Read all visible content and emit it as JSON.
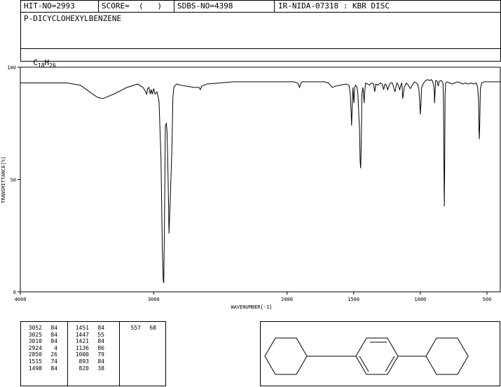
{
  "header": {
    "hit_no": "HIT-NO=2993",
    "score": "SCORE=  (   )",
    "sdbs_no": "SDBS-NO=4398",
    "ir_info": "IR-NIDA-07318 : KBR DISC",
    "compound_name": "P-DICYCLOHEXYLBENZENE",
    "formula_c": "C",
    "formula_c_sub": "18",
    "formula_h": "H",
    "formula_h_sub": "26"
  },
  "chart_data": {
    "type": "line",
    "title": "",
    "xlabel": "WAVENUMBER[-1]",
    "ylabel": "TRANSMITTANCE[%]",
    "xlim": [
      4000,
      400
    ],
    "ylim": [
      0,
      100
    ],
    "x_ticks": [
      4000,
      3000,
      2000,
      1500,
      1000,
      500
    ],
    "x_tick_labels": [
      "4000",
      "3000",
      "2000",
      "1500",
      "1000",
      "500"
    ],
    "y_ticks": [
      0,
      50,
      100
    ],
    "y_tick_labels": [
      "0",
      "50",
      "100"
    ],
    "grid": false,
    "series": [
      {
        "x": [
          4000,
          3800,
          3650,
          3550,
          3480,
          3420,
          3380,
          3300,
          3200,
          3120,
          3080,
          3060,
          3052,
          3045,
          3035,
          3025,
          3018,
          3010,
          3000,
          2990,
          2975,
          2960,
          2945,
          2935,
          2928,
          2924,
          2919,
          2912,
          2905,
          2900,
          2895,
          2890,
          2885,
          2875,
          2862,
          2856,
          2850,
          2845,
          2838,
          2825,
          2800,
          2750,
          2700,
          2660,
          2650,
          2640,
          2600,
          2500,
          2400,
          2300,
          2200,
          2100,
          2000,
          1950,
          1920,
          1905,
          1895,
          1885,
          1860,
          1800,
          1750,
          1720,
          1690,
          1660,
          1640,
          1600,
          1560,
          1535,
          1525,
          1519,
          1515,
          1511,
          1505,
          1500,
          1498,
          1492,
          1485,
          1475,
          1468,
          1462,
          1456,
          1451,
          1447,
          1443,
          1438,
          1430,
          1425,
          1421,
          1417,
          1410,
          1395,
          1380,
          1365,
          1350,
          1342,
          1334,
          1320,
          1300,
          1285,
          1275,
          1265,
          1255,
          1245,
          1225,
          1210,
          1200,
          1190,
          1180,
          1175,
          1165,
          1155,
          1145,
          1140,
          1136,
          1132,
          1120,
          1105,
          1090,
          1075,
          1060,
          1045,
          1030,
          1020,
          1010,
          1005,
          1000,
          995,
          990,
          975,
          960,
          945,
          930,
          920,
          910,
          900,
          895,
          893,
          890,
          885,
          875,
          865,
          860,
          850,
          840,
          830,
          826,
          823,
          820,
          817,
          814,
          810,
          800,
          780,
          760,
          740,
          720,
          700,
          680,
          660,
          640,
          620,
          600,
          580,
          570,
          563,
          560,
          557,
          554,
          550,
          540,
          520,
          500,
          480,
          460,
          440,
          420,
          400
        ],
        "y": [
          93,
          93,
          93,
          92,
          89,
          86.5,
          86,
          88,
          91,
          92.5,
          91,
          89,
          88,
          90.5,
          91,
          88,
          90,
          88,
          90.5,
          88,
          89,
          85,
          60,
          20,
          5,
          4,
          30,
          74,
          75,
          72,
          60,
          45,
          26,
          42,
          66,
          86,
          90.5,
          91.5,
          92,
          92.5,
          92,
          91.5,
          91,
          91,
          90,
          91.5,
          92.5,
          93,
          93.5,
          93.5,
          93.5,
          93.5,
          93.5,
          93.5,
          93,
          91,
          93,
          93.5,
          93.5,
          93.5,
          93.5,
          93.5,
          93,
          91,
          91.5,
          92,
          92.5,
          92,
          88,
          80,
          74,
          82,
          91,
          86,
          84,
          91,
          92,
          91,
          88,
          80,
          72,
          58,
          55,
          65,
          88,
          91,
          87,
          84,
          89,
          93,
          92.5,
          92,
          93,
          92.5,
          89,
          92.5,
          92,
          93,
          92.5,
          90,
          92.5,
          92,
          90,
          93,
          93,
          91,
          89,
          92,
          93,
          92,
          90,
          92,
          93,
          91,
          86,
          91,
          93,
          92,
          90.5,
          92,
          93.5,
          93,
          92.5,
          90,
          85,
          79,
          84,
          91,
          93,
          94,
          94.5,
          94,
          94.5,
          94,
          92,
          89,
          84,
          88,
          94,
          94,
          91.5,
          93.5,
          94,
          94,
          93,
          85,
          60,
          38,
          58,
          88,
          93,
          93.5,
          93,
          92.5,
          93,
          93.5,
          93,
          92.5,
          93,
          92.5,
          93,
          92.5,
          93,
          91,
          85,
          72,
          68,
          75,
          90,
          93,
          93.5,
          93.5,
          93.5,
          93.5,
          93.5,
          93.5,
          93.5
        ]
      }
    ]
  },
  "peak_table": {
    "col1": [
      [
        "3052",
        "84"
      ],
      [
        "3025",
        "84"
      ],
      [
        "3010",
        "84"
      ],
      [
        "2924",
        "4"
      ],
      [
        "2850",
        "26"
      ],
      [
        "1515",
        "74"
      ],
      [
        "1498",
        "84"
      ]
    ],
    "col2": [
      [
        "1451",
        "84"
      ],
      [
        "1447",
        "55"
      ],
      [
        "1421",
        "84"
      ],
      [
        "1136",
        "86"
      ],
      [
        "1000",
        "79"
      ],
      [
        "893",
        "84"
      ],
      [
        "820",
        "38"
      ]
    ],
    "col3": [
      [
        "557",
        "68"
      ]
    ]
  }
}
